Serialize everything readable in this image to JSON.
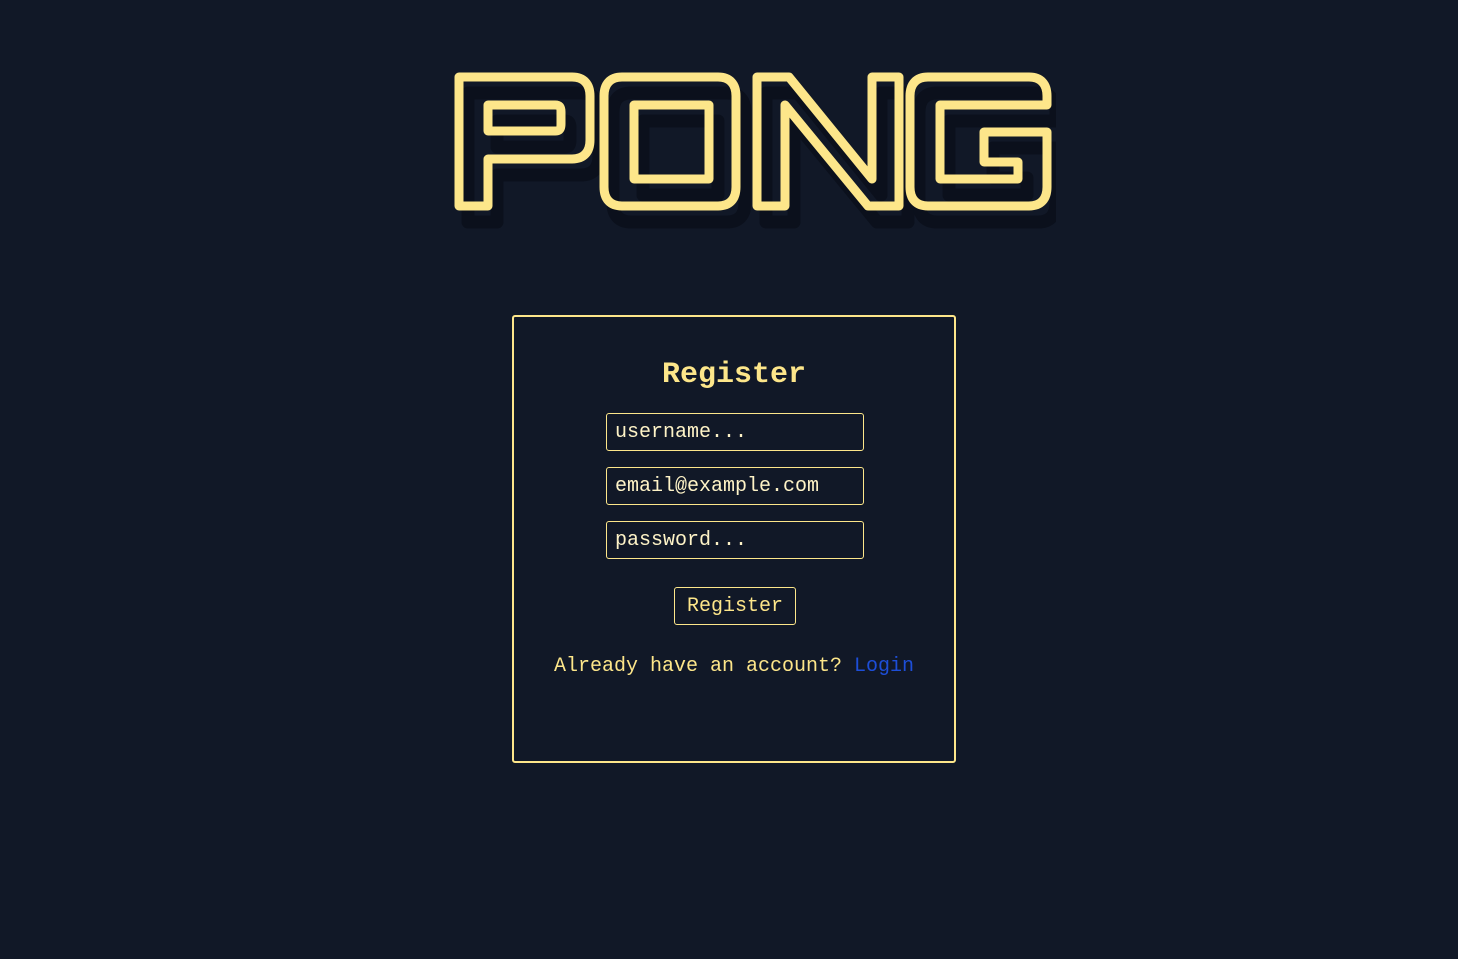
{
  "logo": {
    "text": "PONG"
  },
  "register_form": {
    "title": "Register",
    "fields": {
      "username": {
        "value": "",
        "placeholder": "username..."
      },
      "email": {
        "value": "",
        "placeholder": "email@example.com"
      },
      "password": {
        "value": "",
        "placeholder": "password..."
      }
    },
    "submit_label": "Register",
    "switch_prompt": "Already have an account? ",
    "switch_link_label": "Login"
  },
  "colors": {
    "background": "#111827",
    "accent": "#fde68a",
    "text_light": "#fef3c7",
    "link": "#1d4ed8"
  }
}
